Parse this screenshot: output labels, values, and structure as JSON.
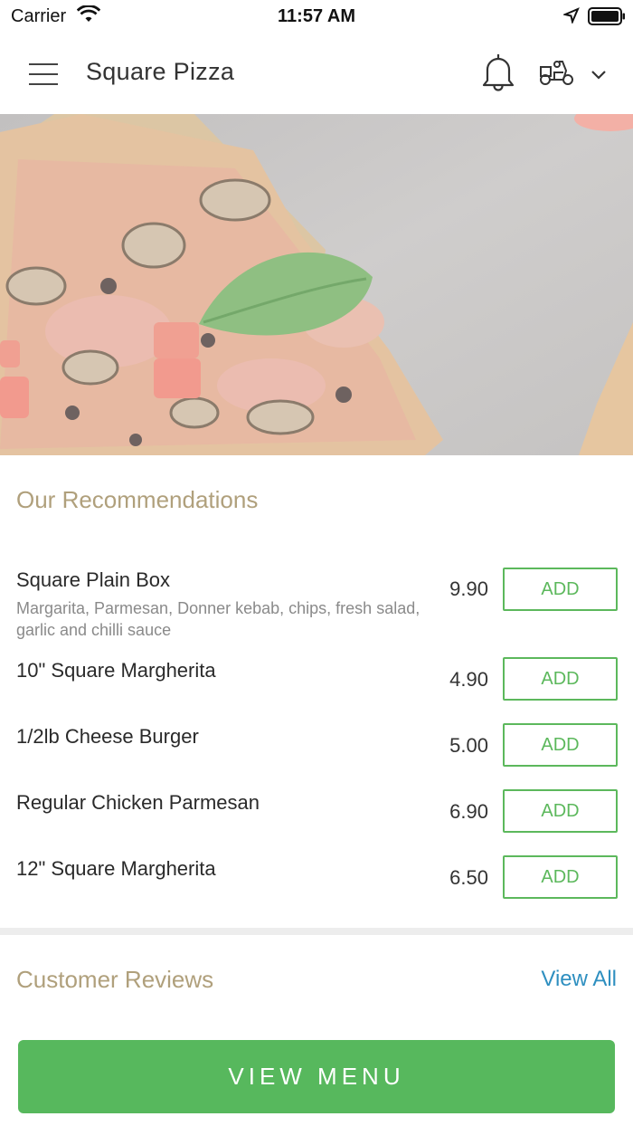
{
  "status_bar": {
    "carrier": "Carrier",
    "time": "11:57 AM"
  },
  "header": {
    "title": "Square Pizza",
    "icons": [
      "menu-icon",
      "bell-icon",
      "scooter-icon",
      "chevron-down-icon"
    ]
  },
  "hero": {
    "image": "pizza-photo"
  },
  "recommendations": {
    "title": "Our Recommendations",
    "items": [
      {
        "name": "Square Plain Box",
        "description": "Margarita, Parmesan, Donner kebab, chips, fresh salad, garlic and chilli sauce",
        "price": "9.90",
        "button": "ADD"
      },
      {
        "name": "10\" Square Margherita",
        "description": "",
        "price": "4.90",
        "button": "ADD"
      },
      {
        "name": "1/2lb Cheese Burger",
        "description": "",
        "price": "5.00",
        "button": "ADD"
      },
      {
        "name": "Regular Chicken Parmesan",
        "description": "",
        "price": "6.90",
        "button": "ADD"
      },
      {
        "name": "12\" Square Margherita",
        "description": "",
        "price": "6.50",
        "button": "ADD"
      }
    ]
  },
  "reviews": {
    "title": "Customer Reviews",
    "view_all": "View All"
  },
  "footer": {
    "view_menu": "VIEW MENU"
  },
  "colors": {
    "accent_green": "#57b85d",
    "section_title": "#b0a07c",
    "link_blue": "#2e8fc0"
  }
}
